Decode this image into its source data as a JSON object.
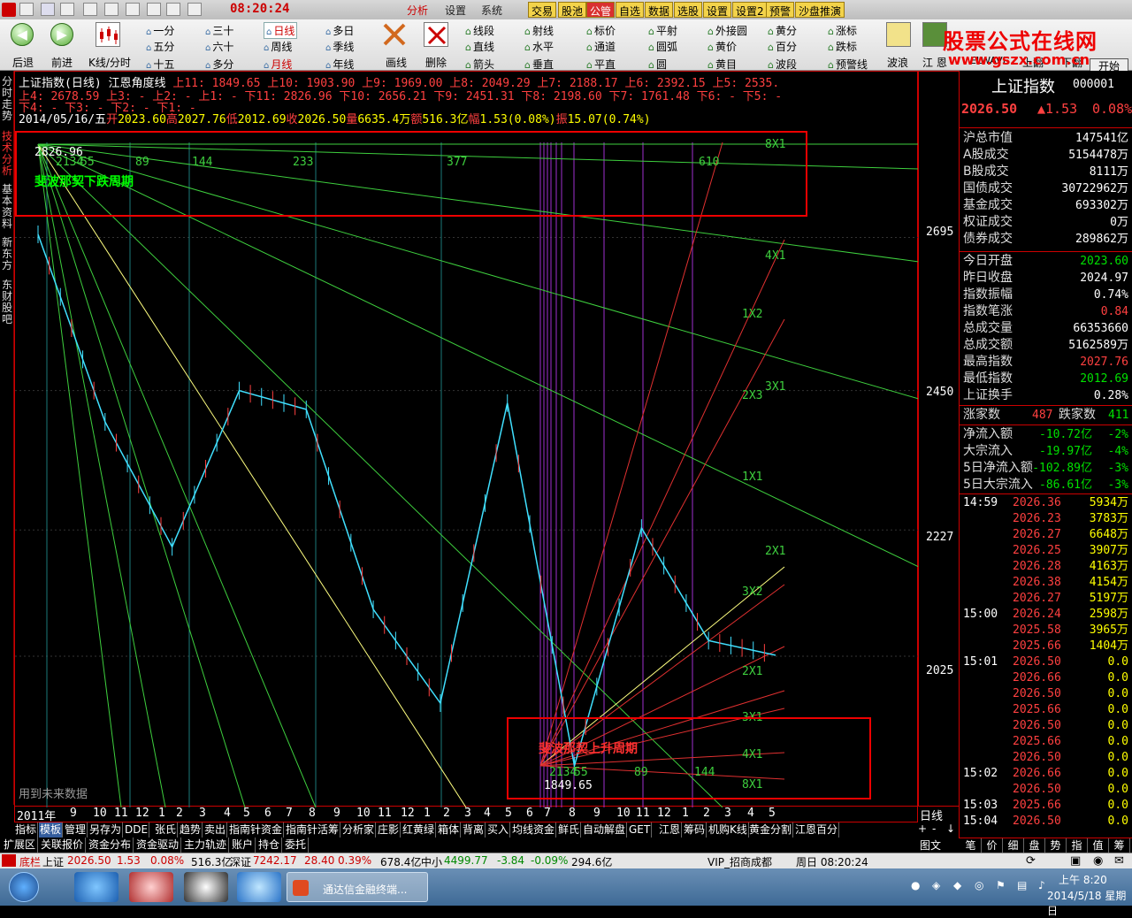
{
  "titlebar": {
    "clock": "08:20:24",
    "menu": [
      "分析",
      "设置",
      "系统"
    ],
    "buttons": [
      "交易",
      "股池",
      "公管",
      "自选",
      "数据",
      "选股",
      "设置",
      "设置2",
      "预警",
      "沙盘推演"
    ]
  },
  "toolbar": {
    "nav": [
      "后退",
      "前进",
      "K线/分时"
    ],
    "periods": [
      [
        "一分",
        "三十",
        "日线",
        "多日"
      ],
      [
        "五分",
        "六十",
        "周线",
        "季线"
      ],
      [
        "十五",
        "多分",
        "月线",
        "年线"
      ]
    ],
    "tools_big": [
      "画线",
      "删除"
    ],
    "tools": [
      [
        "线段",
        "射线",
        "标价",
        "平射",
        "外接圆",
        "黄分",
        "涨标"
      ],
      [
        "直线",
        "水平",
        "通道",
        "圆弧",
        "黄价",
        "百分",
        "跌标"
      ],
      [
        "箭头",
        "垂直",
        "平直",
        "圆",
        "黄目",
        "波段",
        "预警线"
      ]
    ],
    "right_tools": [
      "波浪",
      "江 恩",
      "ELWAVE",
      "上翻",
      "下翻"
    ],
    "start_label": "开始",
    "brand_title": "股票公式在线网",
    "brand_url": "www.gszx.com.cn"
  },
  "sidetabs": [
    "分时走势",
    "技术分析",
    "基本资料",
    "新东方",
    "东财股吧"
  ],
  "chart": {
    "title": "上证指数(日线)",
    "indicator": "江恩角度线",
    "header_line1": "上11: 1849.65 上10: 1903.90 上9: 1969.00 上8: 2049.29 上7: 2188.17 上6: 2392.15 上5: 2535.",
    "header_line2": "上4: 2678.59 上3: - 上2: - 上1: - 下11: 2826.96 下10: 2656.21 下9: 2451.31 下8: 2198.60 下7: 1761.48 下6: - 下5: -",
    "header_line3": "下4: - 下3: - 下2: - 下1: -",
    "date": "2014/05/16/五",
    "open_label": "开",
    "open": "2023.60",
    "high_label": "高",
    "high": "2027.76",
    "low_label": "低",
    "low": "2012.69",
    "close_label": "收",
    "close": "2026.50",
    "vol_label": "量",
    "vol": "6635.4万",
    "amt_label": "额",
    "amt": "516.3亿",
    "chg_label": "幅",
    "chg": "1.53(0.08%)",
    "amp_label": "振",
    "amp": "15.07(0.74%)",
    "high_mark": "2826.96",
    "low_mark": "1849.65",
    "fib_top": [
      "2134",
      "55",
      "89",
      "144",
      "233",
      "377",
      "610"
    ],
    "fib_bottom": [
      "2134",
      "55",
      "89",
      "144"
    ],
    "fib_down_label": "斐波那契下跌周期",
    "fib_up_label": "斐波那契上升周期",
    "future_label": "用到未来数据",
    "gann_top": [
      "8X1",
      "4X1",
      "1X2",
      "3X1",
      "2X3",
      "1X1",
      "2X1",
      "3X2",
      "2X1",
      "3X1",
      "4X1",
      "8X1"
    ],
    "y_ticks": [
      "2695",
      "2450",
      "2227",
      "2025"
    ],
    "x_ticks": [
      "2011年",
      "9",
      "10",
      "11",
      "12",
      "1",
      "2",
      "3",
      "4",
      "5",
      "6",
      "7",
      "8",
      "9",
      "10",
      "11",
      "12",
      "1",
      "2",
      "3",
      "4",
      "5",
      "6",
      "7",
      "8",
      "9",
      "10",
      "11",
      "12",
      "1",
      "2",
      "3",
      "4",
      "5"
    ],
    "period_label": "日线"
  },
  "chart_data": {
    "type": "line",
    "title": "上证指数(日线)",
    "ylim": [
      1800,
      2850
    ],
    "y_ticks": [
      2025,
      2227,
      2450,
      2695
    ],
    "series": [
      {
        "name": "上证指数",
        "x": [
          "2011-08",
          "2011-10",
          "2011-12",
          "2012-02",
          "2012-05",
          "2012-08",
          "2012-12",
          "2013-02",
          "2013-06",
          "2013-09",
          "2014-01",
          "2014-05"
        ],
        "values": [
          2700,
          2400,
          2200,
          2450,
          2420,
          2100,
          1950,
          2430,
          1849.65,
          2230,
          2050,
          2026.5
        ]
      }
    ]
  },
  "indicator_tabs": [
    "指标",
    "模板",
    "管理",
    "另存为",
    "DDE",
    "张氏",
    "趋势",
    "卖出",
    "指南针资金",
    "指南针活筹",
    "分析家",
    "庄影",
    "红黄绿",
    "箱体",
    "背离",
    "买入",
    "均线资金",
    "鲜氏",
    "自动解盘",
    "GET",
    "江恩",
    "筹码",
    "机购K线",
    "黄金分割",
    "江恩百分"
  ],
  "indicator_ctl": [
    "+",
    "-",
    "↓"
  ],
  "bottom_tabs": [
    "扩展区",
    "关联报价",
    "资金分布",
    "资金驱动",
    "主力轨迹",
    "账户",
    "持仓",
    "委托"
  ],
  "bottom_right": "图文F10",
  "right_panel": {
    "name": "上证指数",
    "code": "000001",
    "price": "2026.50",
    "change": "▲1.53",
    "pct": "0.08%",
    "rows": [
      {
        "k": "沪总市值",
        "v": "147541亿",
        "c": "white"
      },
      {
        "k": "A股成交",
        "v": "5154478万",
        "c": "white"
      },
      {
        "k": "B股成交",
        "v": "8111万",
        "c": "white"
      },
      {
        "k": "国债成交",
        "v": "30722962万",
        "c": "white"
      },
      {
        "k": "基金成交",
        "v": "693302万",
        "c": "white"
      },
      {
        "k": "权证成交",
        "v": "0万",
        "c": "white"
      },
      {
        "k": "债券成交",
        "v": "289862万",
        "c": "white"
      }
    ],
    "rows2": [
      {
        "k": "今日开盘",
        "v": "2023.60",
        "c": "green"
      },
      {
        "k": "昨日收盘",
        "v": "2024.97",
        "c": "white"
      },
      {
        "k": "指数振幅",
        "v": "0.74%",
        "c": "white"
      },
      {
        "k": "指数笔涨",
        "v": "0.84",
        "c": "red"
      },
      {
        "k": "总成交量",
        "v": "66353660",
        "c": "white"
      },
      {
        "k": "总成交额",
        "v": "5162589万",
        "c": "white"
      },
      {
        "k": "最高指数",
        "v": "2027.76",
        "c": "red"
      },
      {
        "k": "最低指数",
        "v": "2012.69",
        "c": "green"
      },
      {
        "k": "上证换手",
        "v": "0.28%",
        "c": "white"
      }
    ],
    "updown": {
      "up_label": "涨家数",
      "up": "487",
      "down_label": "跌家数",
      "down": "411"
    },
    "flows": [
      {
        "k": "净流入额",
        "v": "-10.72亿",
        "p": "-2%"
      },
      {
        "k": "大宗流入",
        "v": "-19.97亿",
        "p": "-4%"
      },
      {
        "k": "5日净流入额",
        "v": "-102.89亿",
        "p": "-3%"
      },
      {
        "k": "5日大宗流入",
        "v": "-86.61亿",
        "p": "-3%"
      }
    ],
    "ticks": [
      {
        "t": "14:59",
        "p": "2026.36",
        "v": "5934万"
      },
      {
        "t": "",
        "p": "2026.23",
        "v": "3783万"
      },
      {
        "t": "",
        "p": "2026.27",
        "v": "6648万"
      },
      {
        "t": "",
        "p": "2026.25",
        "v": "3907万"
      },
      {
        "t": "",
        "p": "2026.28",
        "v": "4163万"
      },
      {
        "t": "",
        "p": "2026.38",
        "v": "4154万"
      },
      {
        "t": "",
        "p": "2026.27",
        "v": "5197万"
      },
      {
        "t": "15:00",
        "p": "2026.24",
        "v": "2598万"
      },
      {
        "t": "",
        "p": "2025.58",
        "v": "3965万"
      },
      {
        "t": "",
        "p": "2025.66",
        "v": "1404万"
      },
      {
        "t": "15:01",
        "p": "2026.50",
        "v": "0.0"
      },
      {
        "t": "",
        "p": "2026.66",
        "v": "0.0"
      },
      {
        "t": "",
        "p": "2026.50",
        "v": "0.0"
      },
      {
        "t": "",
        "p": "2025.66",
        "v": "0.0"
      },
      {
        "t": "",
        "p": "2026.50",
        "v": "0.0"
      },
      {
        "t": "",
        "p": "2025.66",
        "v": "0.0"
      },
      {
        "t": "",
        "p": "2026.50",
        "v": "0.0"
      },
      {
        "t": "15:02",
        "p": "2026.66",
        "v": "0.0"
      },
      {
        "t": "",
        "p": "2026.50",
        "v": "0.0"
      },
      {
        "t": "15:03",
        "p": "2025.66",
        "v": "0.0"
      },
      {
        "t": "15:04",
        "p": "2026.50",
        "v": "0.0"
      }
    ],
    "tabs": [
      "笔",
      "价",
      "细",
      "盘",
      "势",
      "指",
      "值",
      "筹"
    ]
  },
  "statusbar": {
    "b1": "底栏",
    "sh_label": "上证",
    "sh": "2026.50",
    "sh_chg": "1.53",
    "sh_pct": "0.08%",
    "sh_amt": "516.3亿",
    "sz_label": "深证",
    "sz": "7242.17",
    "sz_chg": "28.40",
    "sz_pct": "0.39%",
    "sz_amt": "678.4亿",
    "zx_label": "中小",
    "zx": "4499.77",
    "zx_chg": "-3.84",
    "zx_pct": "-0.09%",
    "zx_amt": "294.6亿",
    "vip": "VIP_招商成都",
    "week": "周日 08:20:24"
  },
  "taskbar": {
    "active_task": "通达信金融终端...",
    "time": "上午 8:20",
    "date": "2014/5/18 星期日"
  }
}
